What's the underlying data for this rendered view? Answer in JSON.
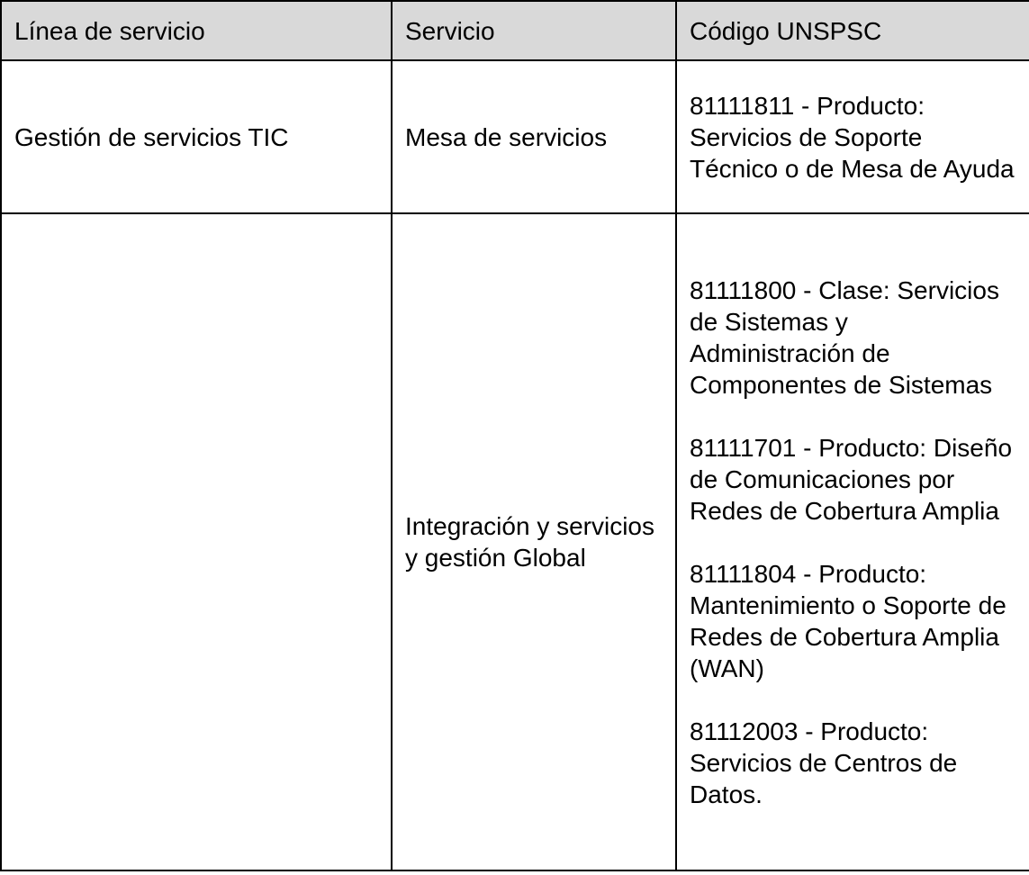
{
  "table": {
    "headers": [
      "Línea de servicio",
      "Servicio",
      "Código UNSPSC"
    ],
    "rows": [
      {
        "linea": "Gestión de servicios TIC",
        "servicio": "Mesa de servicios",
        "codigos": [
          "81111811 - Producto: Servicios de Soporte Técnico o de Mesa de Ayuda"
        ]
      },
      {
        "linea": "",
        "servicio": "Integración y servicios y gestión Global",
        "codigos": [
          "81111800 - Clase: Servicios de Sistemas y Administración de Componentes de Sistemas",
          "81111701 - Producto: Diseño de Comunicaciones por Redes de Cobertura Amplia",
          "81111804 - Producto: Mantenimiento o Soporte de Redes de Cobertura Amplia (WAN)",
          "81112003 - Producto: Servicios de Centros de Datos."
        ]
      }
    ]
  }
}
